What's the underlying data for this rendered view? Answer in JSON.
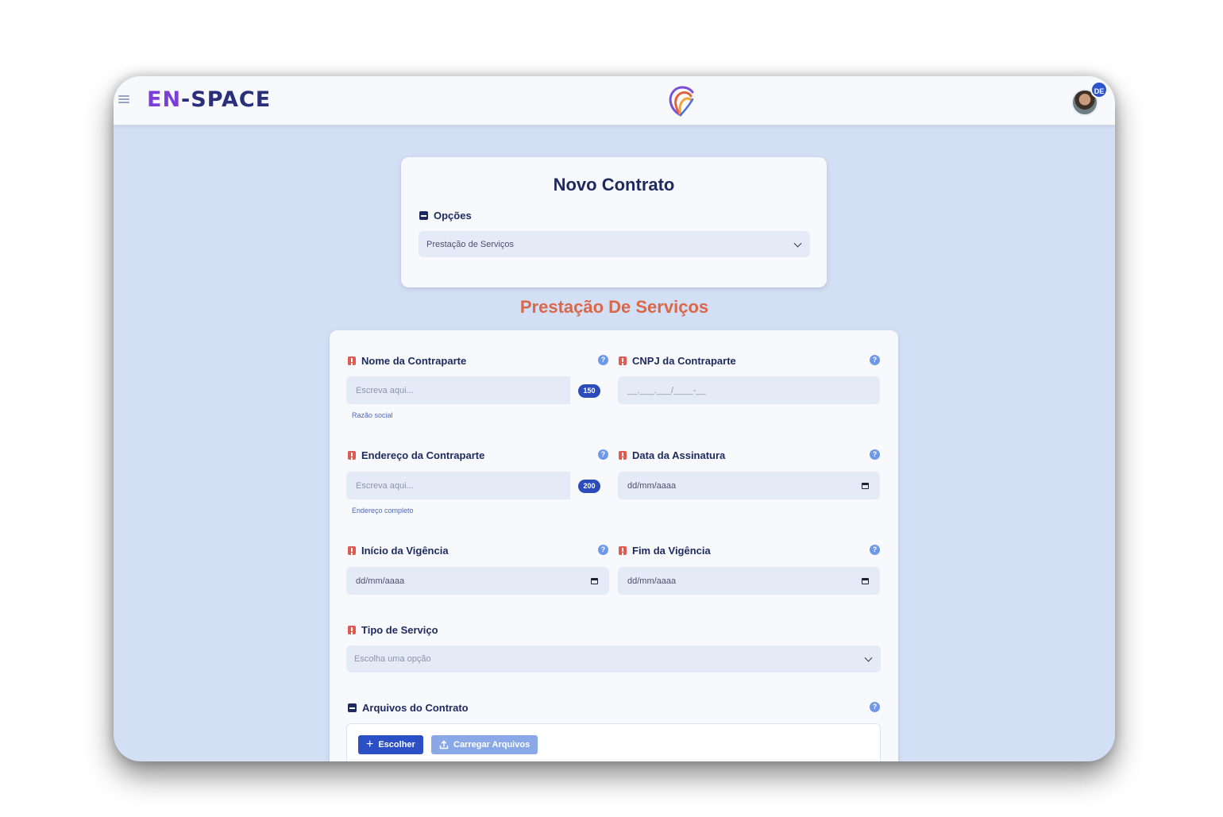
{
  "header": {
    "logo_text_left": "EN",
    "logo_text_right": "-SPACE",
    "avatar_initials": "DE"
  },
  "top_card": {
    "title": "Novo Contrato",
    "options_label": "Opções",
    "options_selected": "Prestação de Serviços"
  },
  "form": {
    "title": "Prestação De Serviços",
    "fields": {
      "counterparty_name": {
        "label": "Nome da Contraparte",
        "placeholder": "Escreva aqui...",
        "counter": "150",
        "hint": "Razão social"
      },
      "counterparty_cnpj": {
        "label": "CNPJ da Contraparte",
        "placeholder": "__.___.___/____-__"
      },
      "counterparty_address": {
        "label": "Endereço da Contraparte",
        "placeholder": "Escreva aqui...",
        "counter": "200",
        "hint": "Endereço completo"
      },
      "signature_date": {
        "label": "Data da Assinatura",
        "placeholder": "dd/mm/aaaa"
      },
      "term_start": {
        "label": "Início da Vigência",
        "placeholder": "dd/mm/aaaa"
      },
      "term_end": {
        "label": "Fim da Vigência",
        "placeholder": "dd/mm/aaaa"
      },
      "service_type": {
        "label": "Tipo de Serviço",
        "placeholder": "Escolha uma opção"
      }
    },
    "files": {
      "label": "Arquivos do Contrato",
      "choose_button": "Escolher",
      "upload_button": "Carregar Arquivos"
    },
    "help_glyph": "?"
  },
  "colors": {
    "brand_navy": "#1e2a5e",
    "accent_orange": "#d9684a",
    "required_red": "#e15a52",
    "primary_blue": "#2b4fc4",
    "background": "#d3dff4"
  }
}
